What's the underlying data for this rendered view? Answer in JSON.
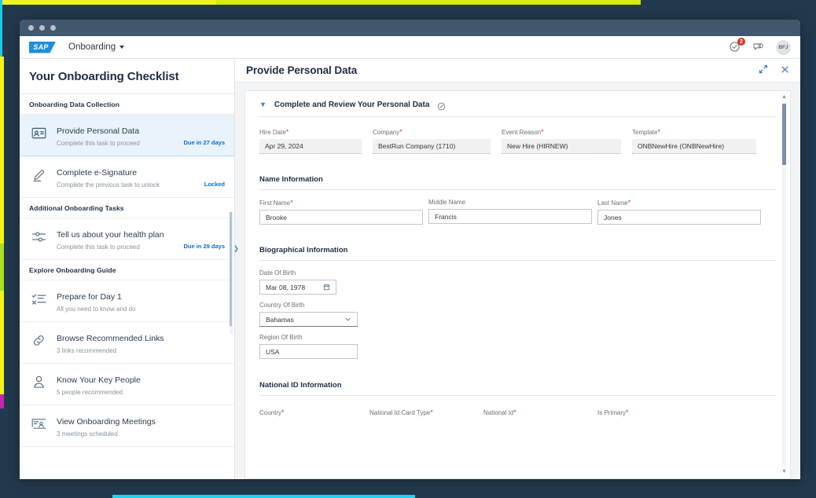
{
  "window": {
    "dots": 3
  },
  "shell": {
    "logo": "SAP",
    "app_name": "Onboarding",
    "icons": {
      "tasks": "check-circle-icon",
      "notifications_count": "2",
      "messages": "chat-icon"
    },
    "avatar_initials": "BFJ"
  },
  "sidebar": {
    "title": "Your Onboarding Checklist",
    "groups": [
      {
        "heading": "Onboarding Data Collection",
        "items": [
          {
            "icon": "id-card-icon",
            "title": "Provide Personal Data",
            "subtitle": "Complete this task to proceed",
            "meta": "Due in 27 days",
            "active": true
          },
          {
            "icon": "signature-pen-icon",
            "title": "Complete e-Signature",
            "subtitle": "Complete the previous task to unlock",
            "meta": "Locked",
            "active": false
          }
        ]
      },
      {
        "heading": "Additional Onboarding Tasks",
        "items": [
          {
            "icon": "settings-sliders-icon",
            "title": "Tell us about your health plan",
            "subtitle": "Complete this task to proceed",
            "meta": "Due in 29 days",
            "active": false
          }
        ]
      },
      {
        "heading": "Explore Onboarding Guide",
        "items": [
          {
            "icon": "checklist-icon",
            "title": "Prepare for Day 1",
            "subtitle": "All you need to know and do",
            "meta": "",
            "active": false
          },
          {
            "icon": "link-chain-icon",
            "title": "Browse Recommended Links",
            "subtitle": "3 links recommended",
            "meta": "",
            "active": false
          },
          {
            "icon": "person-icon",
            "title": "Know Your Key People",
            "subtitle": "5 people recommended",
            "meta": "",
            "active": false
          },
          {
            "icon": "meeting-calendar-icon",
            "title": "View Onboarding Meetings",
            "subtitle": "3 meetings scheduled",
            "meta": "",
            "active": false
          }
        ]
      }
    ]
  },
  "main": {
    "title": "Provide Personal Data",
    "actions": {
      "expand": "expand-icon",
      "close": "close-icon"
    },
    "section": {
      "label": "Complete and Review Your Personal Data",
      "status_icon": "check-circle-outline-icon",
      "collapse_icon": "chevron-down-icon"
    },
    "top_fields": [
      {
        "label": "Hire Date",
        "required": true,
        "value": "Apr 29, 2024",
        "readonly": true
      },
      {
        "label": "Company",
        "required": true,
        "value": "BestRun Company (1710)",
        "readonly": true
      },
      {
        "label": "Event Reason",
        "required": true,
        "value": "New Hire (HIRNEW)",
        "readonly": true
      },
      {
        "label": "Template",
        "required": true,
        "value": "ONBNewHire (ONBNewHire)",
        "readonly": true
      }
    ],
    "name_information": {
      "heading": "Name Information",
      "fields": [
        {
          "label": "First Name",
          "required": true,
          "value": "Brooke"
        },
        {
          "label": "Middle Name",
          "required": false,
          "value": "Francis"
        },
        {
          "label": "Last Name",
          "required": true,
          "value": "Jones"
        }
      ]
    },
    "biographical_information": {
      "heading": "Biographical Information",
      "fields": [
        {
          "label": "Date Of Birth",
          "required": false,
          "value": "Mar 08, 1978",
          "control": "date",
          "icon": "calendar-icon"
        },
        {
          "label": "Country Of Birth",
          "required": false,
          "value": "Bahamas",
          "control": "select",
          "icon": "chevron-down-icon"
        },
        {
          "label": "Region Of Birth",
          "required": false,
          "value": "USA",
          "control": "text"
        }
      ]
    },
    "national_id_information": {
      "heading": "National ID Information",
      "columns": [
        {
          "label": "Country",
          "required": true
        },
        {
          "label": "National Id Card Type",
          "required": true
        },
        {
          "label": "National Id",
          "required": true
        },
        {
          "label": "Is Primary",
          "required": true
        }
      ]
    }
  },
  "colors": {
    "sap_blue": "#0a6ed1",
    "accent_dark": "#1d2d44",
    "required_red": "#d92f67",
    "badge_red": "#d9342b",
    "active_row": "#e8f3fc"
  }
}
